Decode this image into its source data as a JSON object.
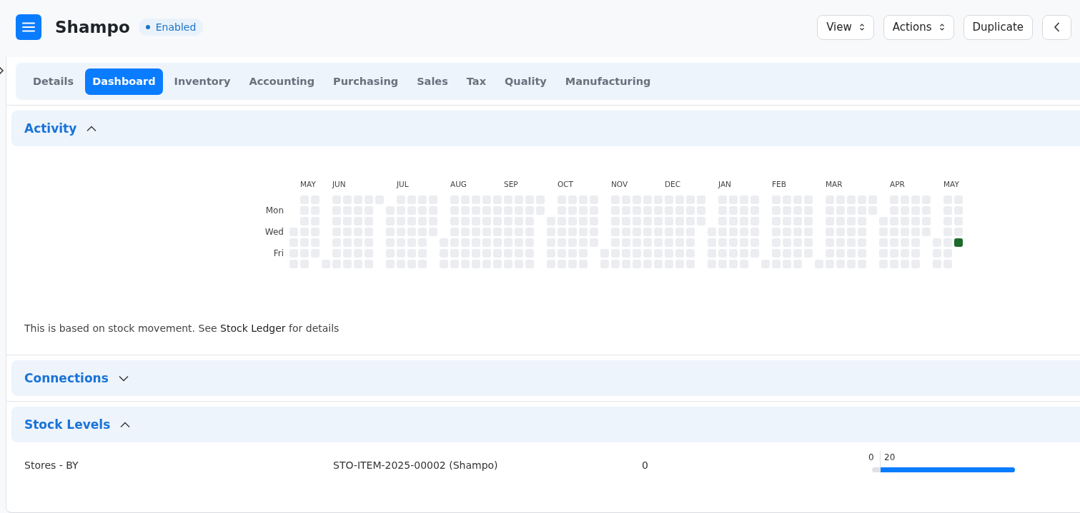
{
  "header": {
    "title": "Shampo",
    "status": "Enabled",
    "buttons": [
      {
        "label": "View",
        "kind": "dropdown"
      },
      {
        "label": "Actions",
        "kind": "dropdown"
      },
      {
        "label": "Duplicate",
        "kind": "plain"
      },
      {
        "kind": "back"
      }
    ]
  },
  "tabs": [
    {
      "label": "Details",
      "selected": false
    },
    {
      "label": "Dashboard",
      "selected": true
    },
    {
      "label": "Inventory",
      "selected": false
    },
    {
      "label": "Accounting",
      "selected": false
    },
    {
      "label": "Purchasing",
      "selected": false
    },
    {
      "label": "Sales",
      "selected": false
    },
    {
      "label": "Tax",
      "selected": false
    },
    {
      "label": "Quality",
      "selected": false
    },
    {
      "label": "Manufacturing",
      "selected": false
    }
  ],
  "activity": {
    "title": "Activity",
    "expanded": true,
    "month_labels": [
      "MAY",
      "JUN",
      "JUL",
      "AUG",
      "SEP",
      "OCT",
      "NOV",
      "DEC",
      "JAN",
      "FEB",
      "MAR",
      "APR",
      "MAY"
    ],
    "day_labels": [
      "Mon",
      "Wed",
      "Fri"
    ],
    "note_before": "This is based on stock movement. See ",
    "note_link": "Stock Ledger",
    "note_after": " for details"
  },
  "connections": {
    "title": "Connections",
    "expanded": false
  },
  "stock_levels": {
    "title": "Stock Levels",
    "expanded": true,
    "rows": [
      {
        "warehouse": "Stores - BY",
        "item": "STO-ITEM-2025-00002 (Shampo)",
        "quantity": "0",
        "scale_start": "0",
        "scale_end": "20",
        "level": 0.94
      }
    ]
  }
}
